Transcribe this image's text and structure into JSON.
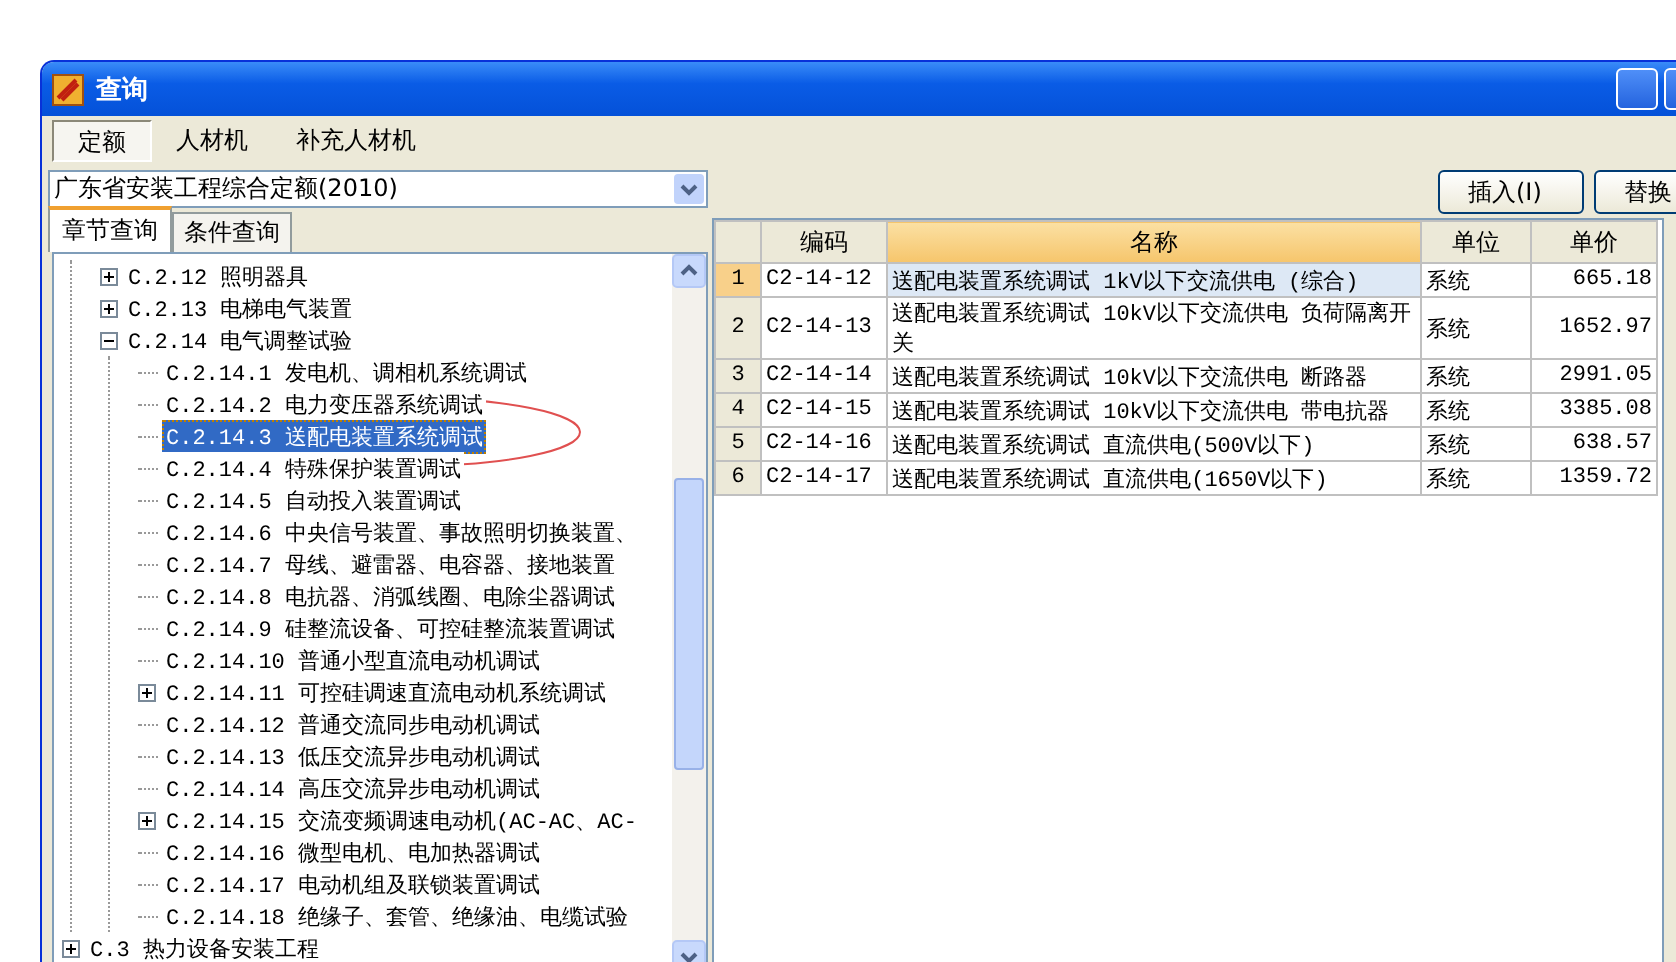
{
  "window": {
    "title": "查询"
  },
  "tabs": [
    {
      "label": "定额",
      "selected": true
    },
    {
      "label": "人材机",
      "selected": false
    },
    {
      "label": "补充人材机",
      "selected": false
    }
  ],
  "library_select": {
    "value": "广东省安装工程综合定额(2010)"
  },
  "subtabs": [
    {
      "label": "章节查询",
      "selected": true
    },
    {
      "label": "条件查询",
      "selected": false
    }
  ],
  "tree": {
    "items": [
      {
        "kind": "offscreen",
        "children": [
          {
            "kind": "branch",
            "label": "C.2.12 照明器具",
            "expanded": false,
            "selected": false
          },
          {
            "kind": "branch",
            "label": "C.2.13 电梯电气装置",
            "expanded": false,
            "selected": false
          },
          {
            "kind": "branch",
            "label": "C.2.14 电气调整试验",
            "expanded": true,
            "selected": false,
            "children": [
              {
                "kind": "leaf",
                "label": "C.2.14.1 发电机、调相机系统调试",
                "selected": false
              },
              {
                "kind": "leaf",
                "label": "C.2.14.2 电力变压器系统调试",
                "selected": false
              },
              {
                "kind": "leaf",
                "label": "C.2.14.3 送配电装置系统调试",
                "selected": true
              },
              {
                "kind": "leaf",
                "label": "C.2.14.4 特殊保护装置调试",
                "selected": false
              },
              {
                "kind": "leaf",
                "label": "C.2.14.5 自动投入装置调试",
                "selected": false
              },
              {
                "kind": "leaf",
                "label": "C.2.14.6 中央信号装置、事故照明切换装置、",
                "selected": false
              },
              {
                "kind": "leaf",
                "label": "C.2.14.7 母线、避雷器、电容器、接地装置",
                "selected": false
              },
              {
                "kind": "leaf",
                "label": "C.2.14.8 电抗器、消弧线圈、电除尘器调试",
                "selected": false
              },
              {
                "kind": "leaf",
                "label": "C.2.14.9 硅整流设备、可控硅整流装置调试",
                "selected": false
              },
              {
                "kind": "leaf",
                "label": "C.2.14.10 普通小型直流电动机调试",
                "selected": false
              },
              {
                "kind": "branch",
                "label": "C.2.14.11 可控硅调速直流电动机系统调试",
                "expanded": false,
                "selected": false
              },
              {
                "kind": "leaf",
                "label": "C.2.14.12 普通交流同步电动机调试",
                "selected": false
              },
              {
                "kind": "leaf",
                "label": "C.2.14.13 低压交流异步电动机调试",
                "selected": false
              },
              {
                "kind": "leaf",
                "label": "C.2.14.14 高压交流异步电动机调试",
                "selected": false
              },
              {
                "kind": "branch",
                "label": "C.2.14.15 交流变频调速电动机(AC-AC、AC-",
                "expanded": false,
                "selected": false
              },
              {
                "kind": "leaf",
                "label": "C.2.14.16 微型电机、电加热器调试",
                "selected": false
              },
              {
                "kind": "leaf",
                "label": "C.2.14.17 电动机组及联锁装置调试",
                "selected": false
              },
              {
                "kind": "leaf",
                "label": "C.2.14.18 绝缘子、套管、绝缘油、电缆试验",
                "selected": false
              }
            ]
          }
        ]
      },
      {
        "kind": "branch",
        "label": "C.3 热力设备安装工程",
        "expanded": false,
        "selected": false
      }
    ]
  },
  "buttons": [
    {
      "label": "插入(I)"
    },
    {
      "label": "替换"
    }
  ],
  "table": {
    "columns": [
      {
        "label": "编码",
        "selected": false
      },
      {
        "label": "名称",
        "selected": true
      },
      {
        "label": "单位",
        "selected": false
      },
      {
        "label": "单价",
        "selected": false
      }
    ],
    "rows": [
      {
        "num": "1",
        "selected": true,
        "cells": [
          "C2-14-12",
          "送配电装置系统调试 1kV以下交流供电 (综合)",
          "系统",
          "665.18"
        ]
      },
      {
        "num": "2",
        "selected": false,
        "cells": [
          "C2-14-13",
          "送配电装置系统调试 10kV以下交流供电 负荷隔离开关",
          "系统",
          "1652.97"
        ]
      },
      {
        "num": "3",
        "selected": false,
        "cells": [
          "C2-14-14",
          "送配电装置系统调试 10kV以下交流供电 断路器",
          "系统",
          "2991.05"
        ]
      },
      {
        "num": "4",
        "selected": false,
        "cells": [
          "C2-14-15",
          "送配电装置系统调试 10kV以下交流供电 带电抗器",
          "系统",
          "3385.08"
        ]
      },
      {
        "num": "5",
        "selected": false,
        "cells": [
          "C2-14-16",
          "送配电装置系统调试 直流供电(500V以下)",
          "系统",
          "638.57"
        ]
      },
      {
        "num": "6",
        "selected": false,
        "cells": [
          "C2-14-17",
          "送配电装置系统调试 直流供电(1650V以下)",
          "系统",
          "1359.72"
        ]
      }
    ]
  }
}
